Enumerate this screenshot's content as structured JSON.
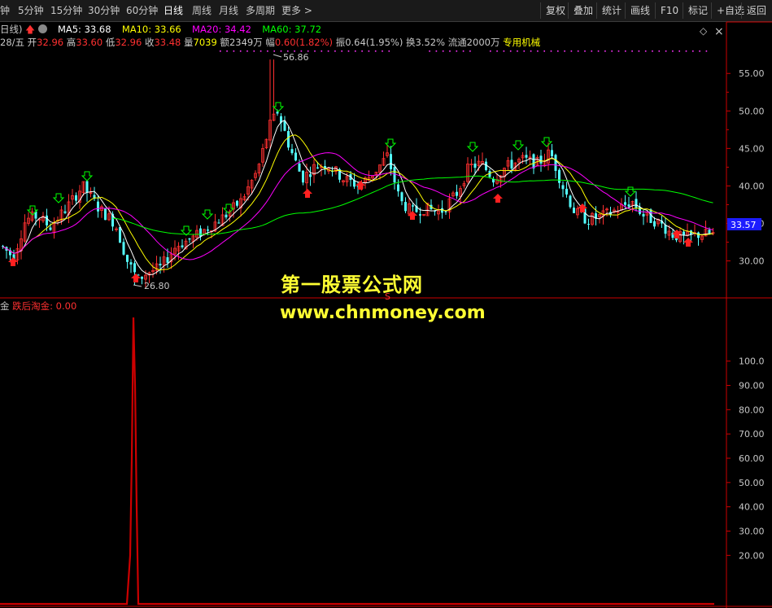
{
  "toolbar": {
    "tabs": [
      {
        "label": "钟",
        "active": false
      },
      {
        "label": "5分钟",
        "active": false
      },
      {
        "label": "15分钟",
        "active": false
      },
      {
        "label": "30分钟",
        "active": false
      },
      {
        "label": "60分钟",
        "active": false
      },
      {
        "label": "日线",
        "active": true
      },
      {
        "label": "周线",
        "active": false
      },
      {
        "label": "月线",
        "active": false
      },
      {
        "label": "多周期",
        "active": false
      },
      {
        "label": "更多 >",
        "active": false
      }
    ],
    "buttons": [
      "复权",
      "叠加",
      "统计",
      "画线",
      "F10",
      "标记",
      "+自选",
      "返回"
    ]
  },
  "info": {
    "period": "日线)",
    "ma5": "MA5: 33.68",
    "ma10": "MA10: 33.66",
    "ma20": "MA20: 34.42",
    "ma60": "MA60: 37.72",
    "date_prefix": "28/五",
    "open_label": "开",
    "open": "32.96",
    "high_label": "高",
    "high": "33.60",
    "low_label": "低",
    "low": "32.96",
    "close_label": "收",
    "close": "33.48",
    "vol_label": "量",
    "vol": "7039",
    "amt_label": "额",
    "amt": "2349万",
    "chg_label": "幅",
    "chg": "0.60(1.82%)",
    "amp": "振0.64(1.95%)",
    "turnover": "换3.52%",
    "float": "流通2000万",
    "industry": "专用机械"
  },
  "indicator": {
    "name_prefix": "金",
    "label": "跌后淘金: 0.00"
  },
  "annotations": {
    "high": "56.86",
    "low": "26.80",
    "current_price": "33.57",
    "s_mark": "S"
  },
  "watermark": {
    "line1": "第一股票公式网",
    "line2": "www.chnmoney.com"
  },
  "price_axis": {
    "ticks": [
      30,
      35,
      40,
      45,
      50,
      55
    ],
    "min": 25.5,
    "max": 58.5,
    "tick_labels": [
      "30.00",
      "35.00",
      "40.00",
      "45.00",
      "50.00",
      "55.00"
    ]
  },
  "indicator_axis": {
    "ticks": [
      20,
      30,
      40,
      50,
      60,
      70,
      80,
      90,
      100
    ],
    "min": 0,
    "max": 120,
    "tick_labels": [
      "20.00",
      "30.00",
      "40.00",
      "50.00",
      "60.00",
      "70.00",
      "80.00",
      "90.00",
      "100.0"
    ]
  },
  "colors": {
    "up": "#ff3030",
    "down": "#54ffff",
    "ma5": "#ffffff",
    "ma10": "#ffff00",
    "ma20": "#ff00ff",
    "ma60": "#00ff00",
    "axis_red": "#cc0000",
    "signal_buy": "#ff2020",
    "signal_sell": "#00ff00",
    "watermark": "#ffff33"
  }
}
